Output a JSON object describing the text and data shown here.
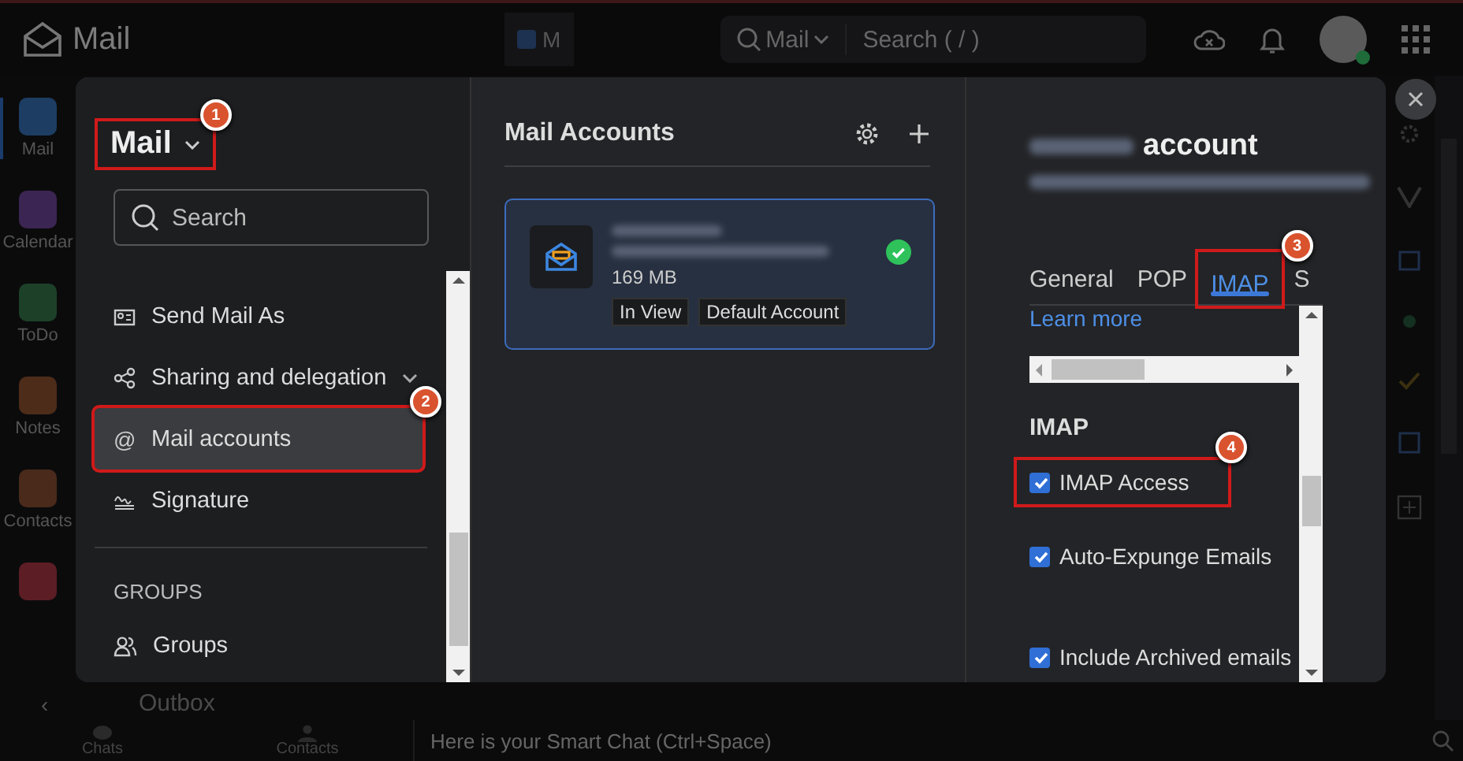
{
  "app": {
    "title": "Mail",
    "tab_label": "M",
    "search_scope": "Mail",
    "search_placeholder": "Search ( / )"
  },
  "rail": [
    {
      "label": "Mail",
      "color": "#1d3d63",
      "selected": true
    },
    {
      "label": "Calendar",
      "color": "#3b2552",
      "selected": false
    },
    {
      "label": "ToDo",
      "color": "#1d4029",
      "selected": false
    },
    {
      "label": "Notes",
      "color": "#4d2c19",
      "selected": false
    },
    {
      "label": "Contacts",
      "color": "#4a2a1b",
      "selected": false
    },
    {
      "color": "#5c1d24",
      "selected": false
    }
  ],
  "behind_text": "Outbox",
  "rail_collapse": "‹",
  "bottom_bar": {
    "items": [
      "Chats",
      "Contacts"
    ],
    "chat_placeholder": "Here is your Smart Chat (Ctrl+Space)"
  },
  "dialog": {
    "menu": {
      "title": "Mail",
      "annotation": "1",
      "search_placeholder": "Search",
      "items": [
        {
          "label": "Send Mail As",
          "kind": "card",
          "selected": false
        },
        {
          "label": "Sharing and delegation",
          "kind": "share",
          "expandable": true,
          "selected": false
        },
        {
          "label": "Mail accounts",
          "kind": "glyph",
          "glyph": "@",
          "selected": true,
          "annotation": "2"
        },
        {
          "label": "Signature",
          "kind": "signature",
          "selected": false
        }
      ],
      "group_heading": "GROUPS",
      "group_items": [
        {
          "label": "Groups",
          "kind": "people",
          "selected": false
        }
      ]
    },
    "accounts": {
      "title": "Mail Accounts",
      "items": [
        {
          "size": "169 MB",
          "tags": [
            "In View",
            "Default Account"
          ],
          "selected": true,
          "verified": true
        }
      ]
    },
    "detail": {
      "title": "account",
      "tabs": [
        {
          "label": "General",
          "selected": false
        },
        {
          "label": "POP",
          "selected": false
        },
        {
          "label": "IMAP",
          "selected": true,
          "annotation": "3"
        },
        {
          "label": "S",
          "selected": false
        }
      ],
      "link": "Learn more",
      "section": "IMAP",
      "options": [
        {
          "label": "IMAP Access",
          "checked": true,
          "annotation": "4"
        },
        {
          "label": "Auto-Expunge Emails",
          "checked": true
        },
        {
          "label": "Include Archived emails",
          "checked": true
        }
      ]
    }
  }
}
